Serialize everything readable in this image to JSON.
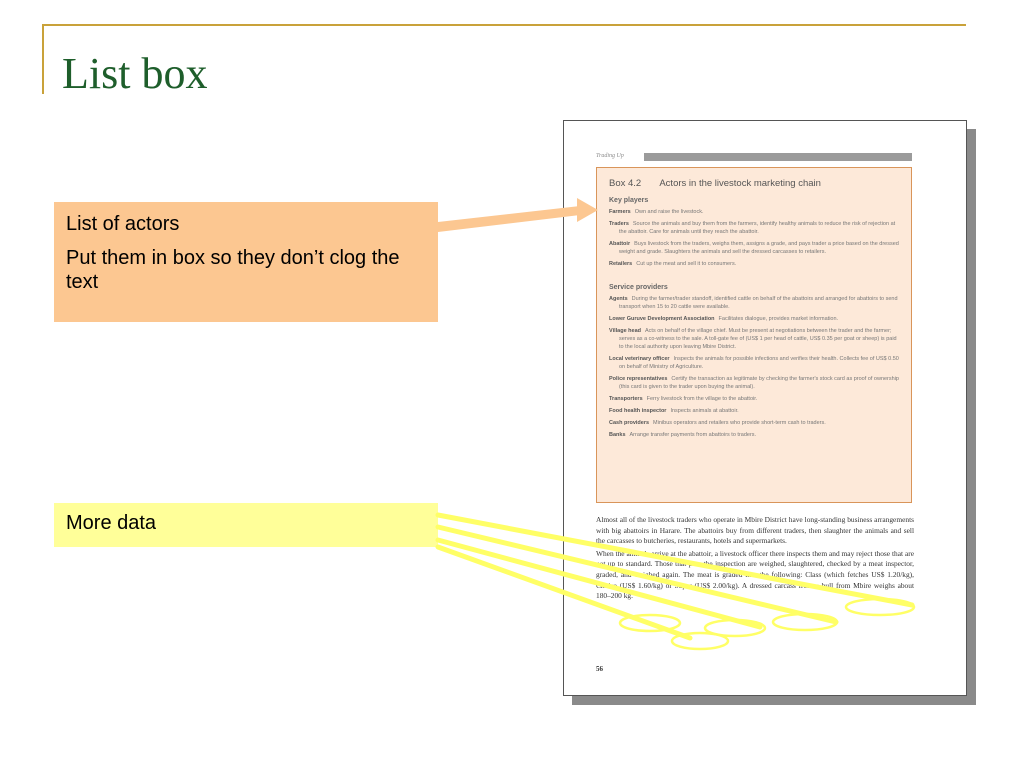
{
  "slide": {
    "title": "List box"
  },
  "callouts": {
    "actors": {
      "line1": "List of actors",
      "line2": "Put them in box so they don’t clog the text"
    },
    "more": {
      "label": "More data"
    }
  },
  "page": {
    "running_head": "Trading Up",
    "box": {
      "number": "Box 4.2",
      "title": "Actors in the livestock marketing chain",
      "key_players_heading": "Key players",
      "key_players": [
        {
          "term": "Farmers",
          "text": "Own and raise the livestock."
        },
        {
          "term": "Traders",
          "text": "Source the animals and buy them from the farmers, identify healthy animals to reduce the risk of rejection at the abattoir. Care for animals until they reach the abattoir."
        },
        {
          "term": "Abattoir",
          "text": "Buys livestock from the traders, weighs them, assigns a grade, and pays trader a price based on the dressed weight and grade. Slaughters the animals and sell the dressed carcasses to retailers."
        },
        {
          "term": "Retailers",
          "text": "Cut up the meat and sell it to consumers."
        }
      ],
      "service_providers_heading": "Service providers",
      "service_providers": [
        {
          "term": "Agents",
          "text": "During the farmer/trader standoff, identified cattle on behalf of the abattoirs and arranged for abattoirs to send transport when 15 to 20 cattle were available."
        },
        {
          "term": "Lower Guruve Development Association",
          "text": "Facilitates dialogue, provides market information."
        },
        {
          "term": "Village head",
          "text": "Acts on behalf of the village chief. Must be present at negotiations between the trader and the farmer; serves as a co-witness to the sale. A toll-gate fee of (US$ 1 per head of cattle, US$ 0.35 per goat or sheep) is paid to the local authority upon leaving Mbire District."
        },
        {
          "term": "Local veterinary officer",
          "text": "Inspects the animals for possible infections and verifies their health. Collects fee of US$ 0.50 on behalf of Ministry of Agriculture."
        },
        {
          "term": "Police representatives",
          "text": "Certify the transaction as legitimate by checking the farmer's stock card as proof of ownership (this card is given to the trader upon buying the animal)."
        },
        {
          "term": "Transporters",
          "text": "Ferry livestock from the village to the abattoir."
        },
        {
          "term": "Food health inspector",
          "text": "Inspects animals at abattoir."
        },
        {
          "term": "Cash providers",
          "text": "Minibus operators and retailers who provide short-term cash to traders."
        },
        {
          "term": "Banks",
          "text": "Arrange transfer payments from abattoirs to traders."
        }
      ]
    },
    "body": {
      "p1": "Almost all of the livestock traders who operate in Mbire District have long-standing business arrangements with big abattoirs in Harare. The abattoirs buy from different traders, then slaughter the animals and sell the carcasses to butcheries, restaurants, hotels and supermarkets.",
      "p2": "When the animals arrive at the abattoir, a livestock officer there inspects them and may reject those that are not up to standard. Those that pass the inspection are weighed, slaughtered, checked by a meat inspector, graded, and weighed again. The meat is graded into the following: Class (which fetches US$ 1.20/kg), Choice (US$ 1.60/kg) or Super (US$ 2.00/kg). A dressed carcass from a bull from Mbire weighs about 180–200 kg."
    },
    "page_number": "56"
  },
  "colors": {
    "title_green": "#1e5e2b",
    "rule_gold": "#c9a23a",
    "orange_callout": "#fcc791",
    "yellow_callout": "#ffff99",
    "box_fill": "#fde9d9"
  }
}
